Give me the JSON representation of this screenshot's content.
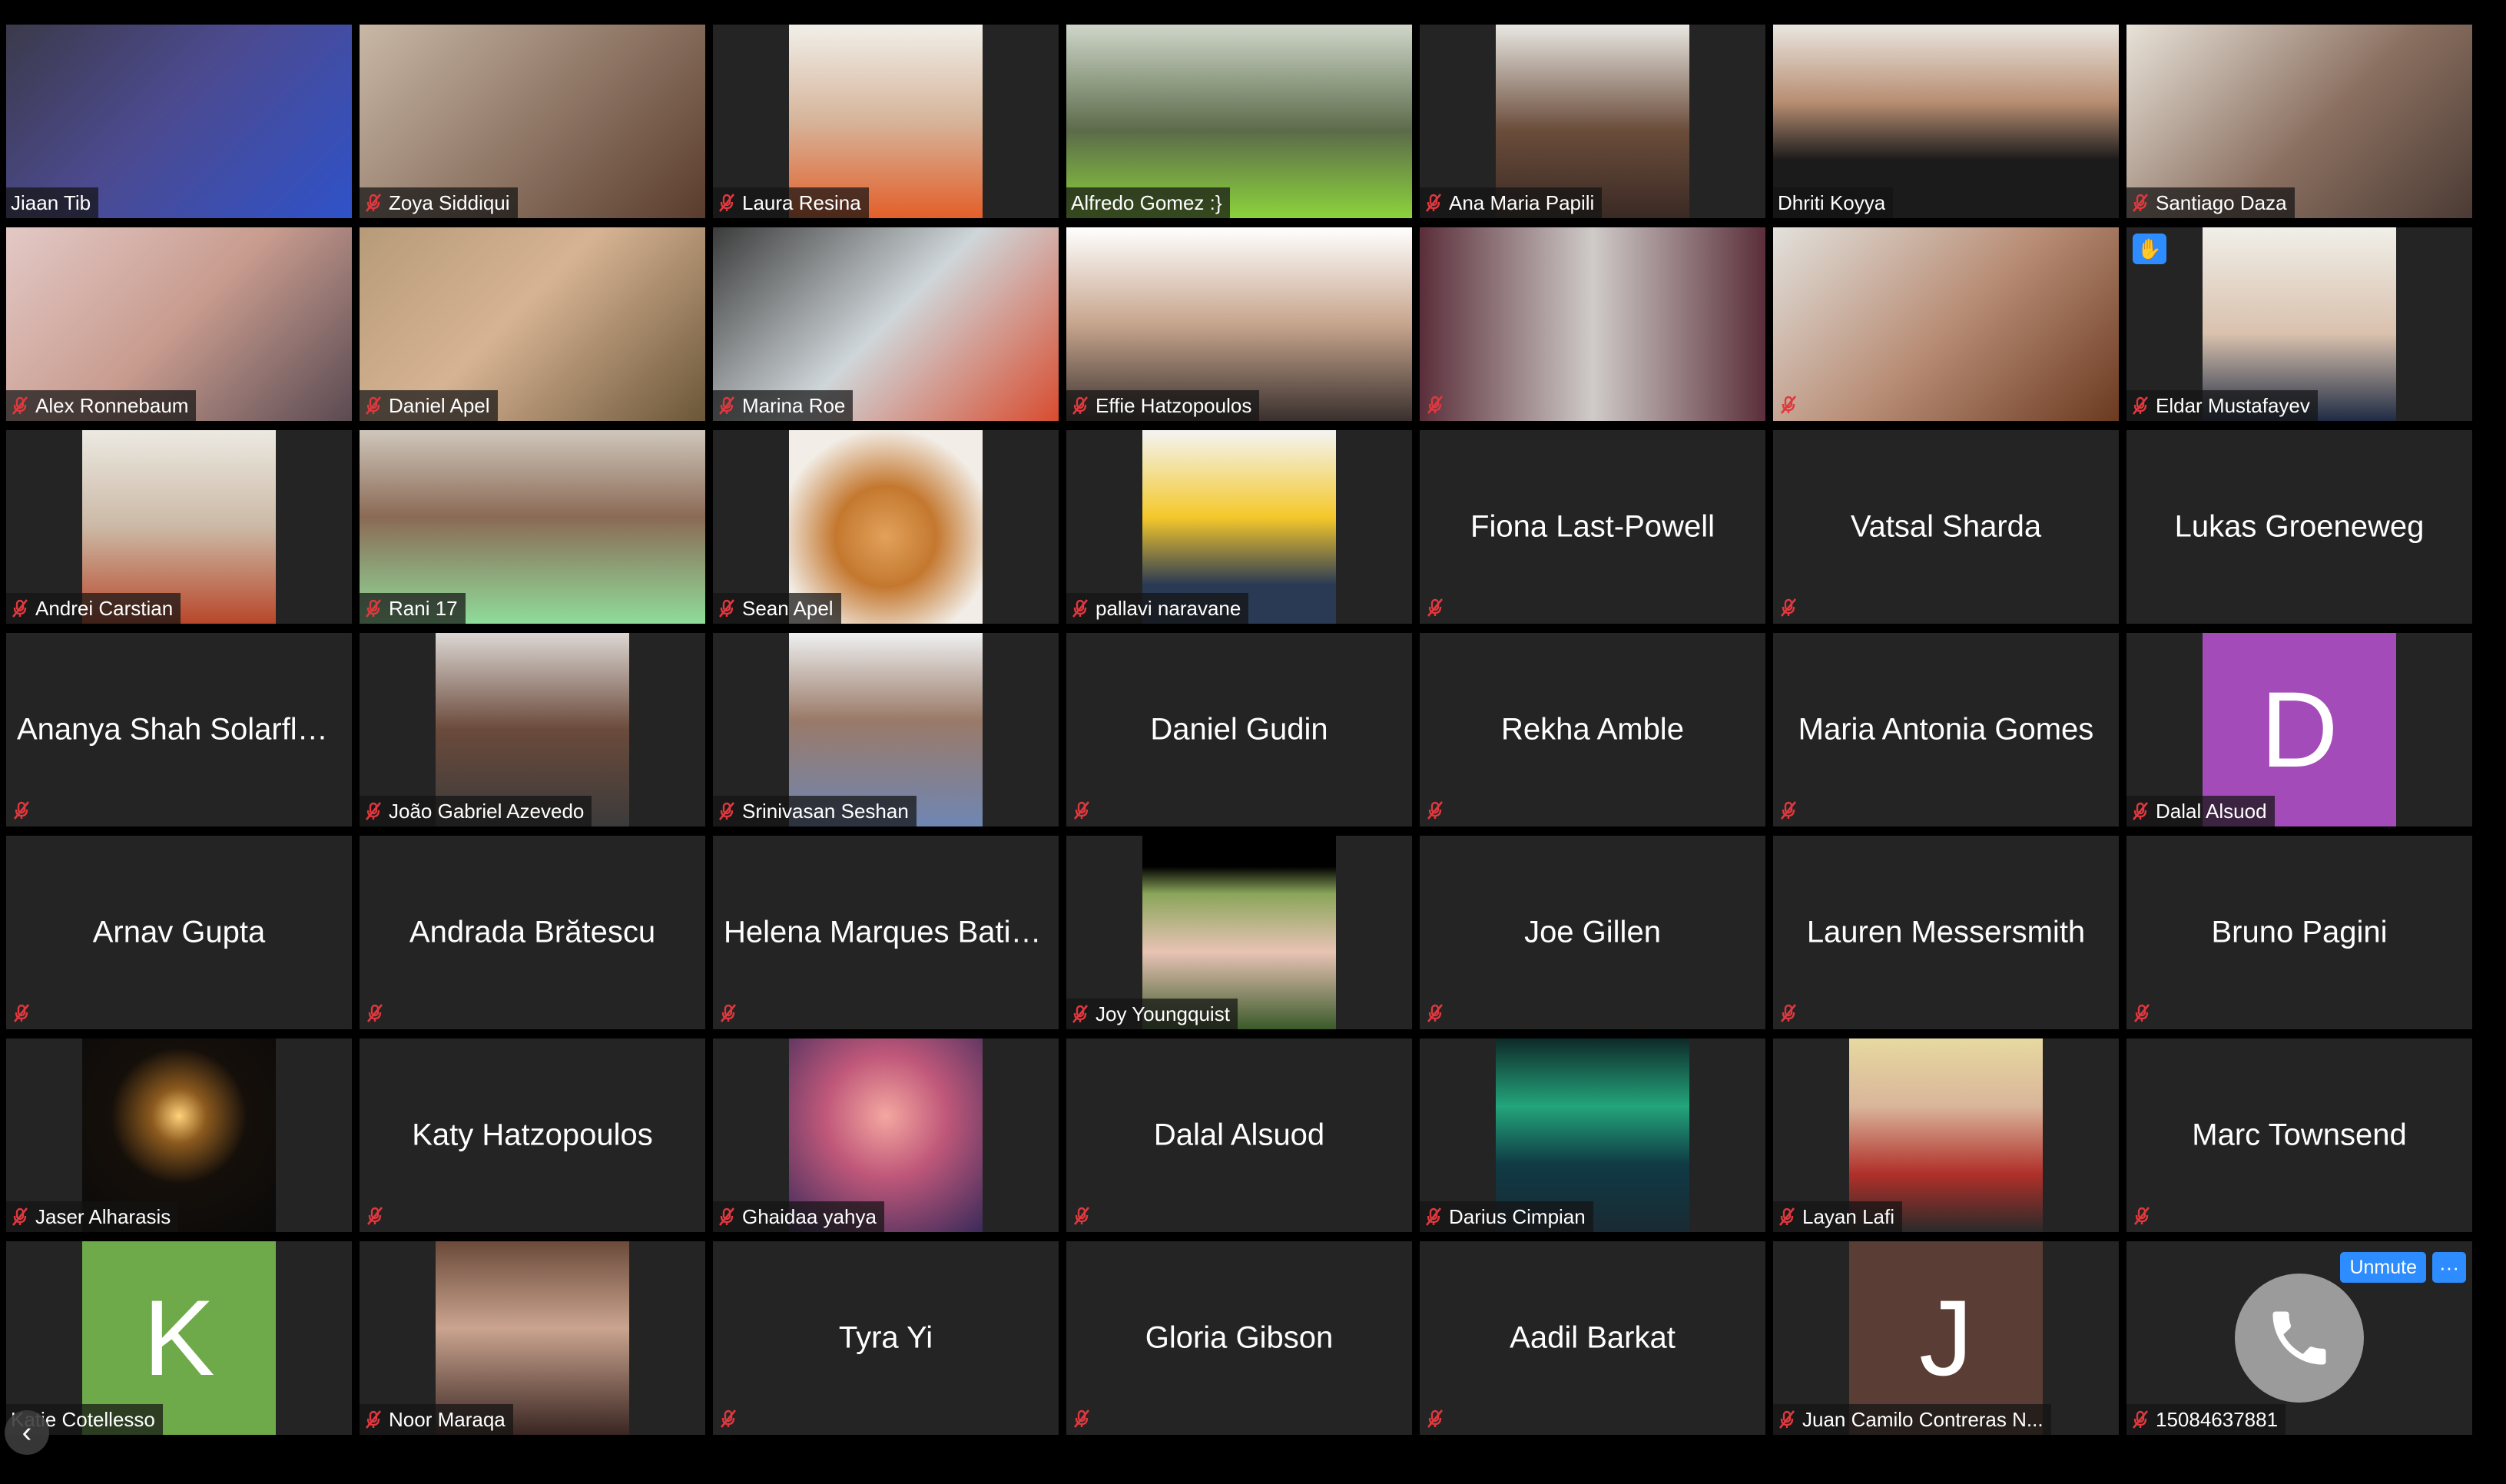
{
  "window": {
    "page_prev_icon": "chevron-left-icon"
  },
  "colors": {
    "tile_bg": "#242424",
    "active_speaker_border": "#d3e189",
    "mute_icon": "#e0383e",
    "zoom_blue": "#2d8cff",
    "phone_circle": "#9b9b9b"
  },
  "participants": [
    {
      "label": "Jiaan Tib",
      "video": true,
      "muted": false,
      "active": true,
      "bg": "linear-gradient(135deg,#3b3a4a 0%,#4c4a8f 45%,#2f52c9 100%)"
    },
    {
      "label": "Zoya Siddiqui",
      "video": true,
      "muted": true,
      "bg": "linear-gradient(135deg,#c9b8a6 0%,#8c7362 55%,#5a3c2c 100%)"
    },
    {
      "label": "Laura Resina",
      "video": true,
      "muted": true,
      "narrow": true,
      "bg": "linear-gradient(180deg,#f1efe9 0%,#d6b49a 50%,#e35f2a 100%)"
    },
    {
      "label": "Alfredo Gomez :}",
      "video": true,
      "muted": false,
      "bg": "linear-gradient(180deg,#cfd6c9 0%,#5c6b4a 55%,#8cd33b 100%)"
    },
    {
      "label": "Ana Maria Papili",
      "video": true,
      "muted": true,
      "narrow": true,
      "bg": "linear-gradient(180deg,#e9e7e2 0%,#6a4c3a 55%,#3a2a24 100%)"
    },
    {
      "label": "Dhriti Koyya",
      "video": true,
      "muted": false,
      "bg": "linear-gradient(180deg,#e9e6e0 0%,#b88e72 40%,#1b1b1b 70%)"
    },
    {
      "label": "Santiago Daza",
      "video": true,
      "muted": true,
      "bg": "linear-gradient(135deg,#e8e2d8 0%,#8a6f60 55%,#4b3b34 100%)"
    },
    {
      "label": "Alex Ronnebaum",
      "video": true,
      "muted": true,
      "bg": "linear-gradient(135deg,#e3c9c6 0%,#c89b8e 50%,#5a4a52 100%)"
    },
    {
      "label": "Daniel Apel",
      "video": true,
      "muted": true,
      "bg": "linear-gradient(135deg,#b79b78 0%,#d6b393 45%,#6b5638 100%)"
    },
    {
      "label": "Marina Roe",
      "video": true,
      "muted": true,
      "bg": "linear-gradient(135deg,#3b3b3b 0%,#cfd6d9 50%,#d84c2f 100%)"
    },
    {
      "label": "Effie Hatzopoulos",
      "video": true,
      "muted": true,
      "bg": "linear-gradient(180deg,#ffffff 0%,#c7a58d 50%,#3a302e 100%)"
    },
    {
      "label": "",
      "video": true,
      "muted": true,
      "bg": "linear-gradient(90deg,#5a2e3a 0%,#cfcbc8 50%,#5a2e3a 100%)"
    },
    {
      "label": "",
      "video": true,
      "muted": true,
      "bg": "linear-gradient(135deg,#e2e1dc 0%,#b98e77 50%,#6b3a20 100%)"
    },
    {
      "label": "Eldar Mustafayev",
      "video": true,
      "muted": true,
      "narrow": true,
      "hand": true,
      "bg": "linear-gradient(180deg,#f0efe9 0%,#d9c1ad 55%,#1f2c44 100%)"
    },
    {
      "label": "Andrei Carstian",
      "video": true,
      "muted": true,
      "narrow": true,
      "bg": "linear-gradient(180deg,#ece9e2 0%,#cbb9a5 50%,#b8472a 100%)"
    },
    {
      "label": "Rani 17",
      "video": true,
      "muted": true,
      "bg": "linear-gradient(180deg,#cfc7bb 0%,#8b6a55 45%,#8fdc9a 100%)"
    },
    {
      "label": "Sean Apel",
      "video": true,
      "muted": true,
      "narrow": true,
      "bg": "radial-gradient(circle at 50% 55%,#e2a15a 0%,#c4782f 35%,#f2ede6 75%)"
    },
    {
      "label": "pallavi naravane",
      "video": true,
      "muted": true,
      "narrow": true,
      "bg": "linear-gradient(180deg,#f4f4f4 0%,#f4c82a 45%,#2a3a55 80%)"
    },
    {
      "label": "Fiona Last-Powell",
      "video": false,
      "muted": true
    },
    {
      "label": "Vatsal Sharda",
      "video": false,
      "muted": true
    },
    {
      "label": "Lukas Groeneweg",
      "video": false,
      "muted": false
    },
    {
      "label": "Ananya Shah Solarflar...",
      "video": false,
      "muted": true
    },
    {
      "label": "João Gabriel Azevedo",
      "video": true,
      "muted": true,
      "narrow": true,
      "bg": "linear-gradient(180deg,#dcd7d3 0%,#6b4a3b 50%,#3b3b3b 100%)"
    },
    {
      "label": "Srinivasan Seshan",
      "video": true,
      "muted": true,
      "narrow": true,
      "bg": "linear-gradient(180deg,#eef0f1 0%,#9a7a68 45%,#6f86b3 100%)"
    },
    {
      "label": "Daniel Gudin",
      "video": false,
      "muted": true
    },
    {
      "label": "Rekha Amble",
      "video": false,
      "muted": true
    },
    {
      "label": "Maria Antonia Gomes",
      "video": false,
      "muted": true
    },
    {
      "label": "Dalal Alsuod",
      "video": false,
      "muted": true,
      "letter": "D",
      "letter_bg": "#a34bb8"
    },
    {
      "label": "Arnav Gupta",
      "video": false,
      "muted": true
    },
    {
      "label": "Andrada Brătescu",
      "video": false,
      "muted": true
    },
    {
      "label": "Helena Marques Batista",
      "video": false,
      "muted": true
    },
    {
      "label": "Joy Youngquist",
      "video": true,
      "muted": true,
      "narrow": true,
      "bg": "linear-gradient(180deg,#000 0%,#000 16%,#8aa55a 30%,#e8c3b4 60%,#3a5a2a 100%)"
    },
    {
      "label": "Joe Gillen",
      "video": false,
      "muted": true
    },
    {
      "label": "Lauren Messersmith",
      "video": false,
      "muted": true
    },
    {
      "label": "Bruno Pagini",
      "video": false,
      "muted": true
    },
    {
      "label": "Jaser Alharasis",
      "video": true,
      "muted": true,
      "narrow": true,
      "bg": "radial-gradient(circle at 50% 40%,#ffd27a 0%,#8c5a1e 18%,#150f0a 45%,#0a0a0a 100%)"
    },
    {
      "label": "Katy Hatzopoulos",
      "video": false,
      "muted": true
    },
    {
      "label": "Ghaidaa yahya",
      "video": true,
      "muted": true,
      "narrow": true,
      "bg": "radial-gradient(circle at 50% 40%,#f4a7a0 0%,#c0587a 40%,#3a2a5a 100%)"
    },
    {
      "label": "Dalal Alsuod",
      "video": false,
      "muted": true
    },
    {
      "label": "Darius Cimpian",
      "video": true,
      "muted": true,
      "narrow": true,
      "bg": "linear-gradient(180deg,#0e2a2a 0%,#23a57a 35%,#0f3a45 65%,#1a2a33 100%)"
    },
    {
      "label": "Layan Lafi",
      "video": true,
      "muted": true,
      "narrow": true,
      "bg": "linear-gradient(180deg,#e7d9a0 0%,#d9b59a 35%,#b0302a 70%,#2a2a2a 100%)"
    },
    {
      "label": "Marc Townsend",
      "video": false,
      "muted": true
    },
    {
      "label": "Katie Cotellesso",
      "video": false,
      "muted": false,
      "letter": "K",
      "letter_bg": "#6eaa49"
    },
    {
      "label": "Noor Maraqa",
      "video": true,
      "muted": true,
      "narrow": true,
      "bg": "linear-gradient(180deg,#6b4a3a 0%,#caa48f 45%,#3a2622 100%)"
    },
    {
      "label": "Tyra Yi",
      "video": false,
      "muted": true
    },
    {
      "label": "Gloria Gibson",
      "video": false,
      "muted": true
    },
    {
      "label": "Aadil Barkat",
      "video": false,
      "muted": true
    },
    {
      "label": "Juan Camilo Contreras N...",
      "video": false,
      "muted": true,
      "letter": "J",
      "letter_bg": "#5a3d34"
    },
    {
      "label": "15084637881",
      "video": false,
      "muted": true,
      "phone": true
    }
  ],
  "phone_tile": {
    "unmute_label": "Unmute",
    "more_label": "···"
  },
  "raise_hand_label": "✋"
}
